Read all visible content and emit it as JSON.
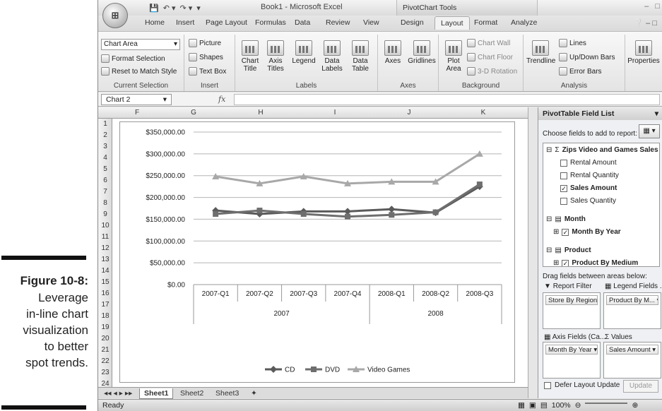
{
  "caption": {
    "figure_label": "Figure 10-8:",
    "lines": [
      "Leverage",
      "in-line chart",
      "visualization",
      "to better",
      "spot trends."
    ]
  },
  "window": {
    "title": "Book1 - Microsoft Excel",
    "context_tab_group": "PivotChart Tools",
    "office_button": "⊞"
  },
  "tabs": [
    "Home",
    "Insert",
    "Page Layout",
    "Formulas",
    "Data",
    "Review",
    "View",
    "Design",
    "Layout",
    "Format",
    "Analyze"
  ],
  "active_tab": "Layout",
  "ribbon": {
    "current_selection": {
      "combo_value": "Chart Area",
      "format_selection": "Format Selection",
      "reset": "Reset to Match Style",
      "label": "Current Selection"
    },
    "insert": {
      "picture": "Picture",
      "shapes": "Shapes",
      "text_box": "Text Box",
      "label": "Insert"
    },
    "labels": {
      "buttons": [
        "Chart Title",
        "Axis Titles",
        "Legend",
        "Data Labels",
        "Data Table"
      ],
      "label": "Labels"
    },
    "axes": {
      "buttons": [
        "Axes",
        "Gridlines"
      ],
      "label": "Axes"
    },
    "background": {
      "plot_area": "Plot Area",
      "chart_wall": "Chart Wall",
      "chart_floor": "Chart Floor",
      "rotation": "3-D Rotation",
      "label": "Background"
    },
    "analysis": {
      "trendline": "Trendline",
      "lines": "Lines",
      "updown": "Up/Down Bars",
      "error": "Error Bars",
      "label": "Analysis"
    },
    "properties": "Properties"
  },
  "formula_bar": {
    "name_box": "Chart 2",
    "fx": "fx"
  },
  "columns": [
    "F",
    "G",
    "H",
    "I",
    "J",
    "K"
  ],
  "rows": [
    "1",
    "2",
    "3",
    "4",
    "5",
    "6",
    "7",
    "8",
    "9",
    "10",
    "11",
    "12",
    "13",
    "14",
    "15",
    "16",
    "17",
    "18",
    "19",
    "20",
    "21",
    "22",
    "23",
    "24"
  ],
  "sheet_tabs": [
    "Sheet1",
    "Sheet2",
    "Sheet3"
  ],
  "active_sheet": "Sheet1",
  "status": {
    "ready": "Ready",
    "zoom": "100%"
  },
  "field_list": {
    "title": "PivotTable Field List",
    "choose": "Choose fields to add to report:",
    "fields": [
      {
        "label": "Zips Video and Games Sales ...",
        "type": "group",
        "checked": null
      },
      {
        "label": "Rental Amount",
        "type": "field",
        "checked": false
      },
      {
        "label": "Rental Quantity",
        "type": "field",
        "checked": false
      },
      {
        "label": "Sales Amount",
        "type": "field",
        "checked": true
      },
      {
        "label": "Sales Quantity",
        "type": "field",
        "checked": false
      },
      {
        "label": "Month",
        "type": "group",
        "checked": null
      },
      {
        "label": "Month By Year",
        "type": "field",
        "checked": true
      },
      {
        "label": "Product",
        "type": "group",
        "checked": null
      },
      {
        "label": "Product By Medium",
        "type": "field",
        "checked": true
      }
    ],
    "drag_label": "Drag fields between areas below:",
    "report_filter": "Report Filter",
    "legend_fields": "Legend Fields ...",
    "axis_fields": "Axis Fields (Ca...",
    "values": "Values",
    "report_filter_item": "Store By Region",
    "legend_item": "Product By M...",
    "axis_item": "Month By Year",
    "values_item": "Sales Amount",
    "defer": "Defer Layout Update",
    "update": "Update"
  },
  "chart_data": {
    "type": "line",
    "categories": [
      "2007-Q1",
      "2007-Q2",
      "2007-Q3",
      "2007-Q4",
      "2008-Q1",
      "2008-Q2",
      "2008-Q3"
    ],
    "groups": [
      {
        "label": "2007",
        "span": 4
      },
      {
        "label": "2008",
        "span": 3
      }
    ],
    "series": [
      {
        "name": "CD",
        "values": [
          170000,
          162000,
          168000,
          168000,
          173000,
          165000,
          225000
        ],
        "color": "#5a5a5a",
        "marker": "diamond"
      },
      {
        "name": "DVD",
        "values": [
          162000,
          170000,
          162000,
          156000,
          160000,
          166000,
          230000
        ],
        "color": "#6e6e6e",
        "marker": "square"
      },
      {
        "name": "Video Games",
        "values": [
          248000,
          232000,
          248000,
          232000,
          236000,
          236000,
          300000
        ],
        "color": "#a8a8a8",
        "marker": "triangle"
      }
    ],
    "ylim": [
      0,
      350000
    ],
    "yticks": [
      "$0.00",
      "$50,000.00",
      "$100,000.00",
      "$150,000.00",
      "$200,000.00",
      "$250,000.00",
      "$300,000.00",
      "$350,000.00"
    ],
    "grid": true,
    "legend_position": "bottom"
  }
}
